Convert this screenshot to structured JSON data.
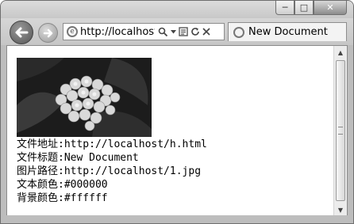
{
  "browser": {
    "address_url": "http://localhost/",
    "tab_title": "New Document",
    "min_symbol": "─",
    "max_symbol": "□",
    "close_symbol": "✕"
  },
  "page": {
    "image_alt": "hydrangea photo",
    "lines": [
      {
        "label": "文件地址:",
        "value": "http://localhost/h.html"
      },
      {
        "label": "文件标题:",
        "value": "New Document"
      },
      {
        "label": "图片路径:",
        "value": "http://localhost/1.jpg"
      },
      {
        "label": "文本颜色:",
        "value": "#000000"
      },
      {
        "label": "背景颜色:",
        "value": "#ffffff"
      }
    ]
  }
}
